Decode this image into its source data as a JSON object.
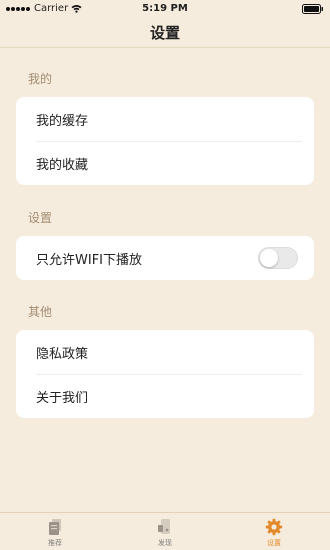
{
  "status_bar": {
    "carrier": "Carrier",
    "time": "5:19 PM"
  },
  "nav": {
    "title": "设置"
  },
  "sections": [
    {
      "header": "我的",
      "rows": [
        {
          "label": "我的缓存"
        },
        {
          "label": "我的收藏"
        }
      ]
    },
    {
      "header": "设置",
      "rows": [
        {
          "label": "只允许WIFI下播放",
          "toggle_on": false
        }
      ]
    },
    {
      "header": "其他",
      "rows": [
        {
          "label": "隐私政策"
        },
        {
          "label": "关于我们"
        }
      ]
    }
  ],
  "tab_bar": {
    "tabs": [
      {
        "label": "推荐",
        "icon": "book-icon",
        "active": false
      },
      {
        "label": "发现",
        "icon": "discover-icon",
        "active": false
      },
      {
        "label": "设置",
        "icon": "gear-icon",
        "active": true
      }
    ]
  },
  "colors": {
    "background": "#f6ecdd",
    "section_header": "#a28c72",
    "accent": "#e28a2b",
    "tab_inactive": "#7d7d7d"
  }
}
